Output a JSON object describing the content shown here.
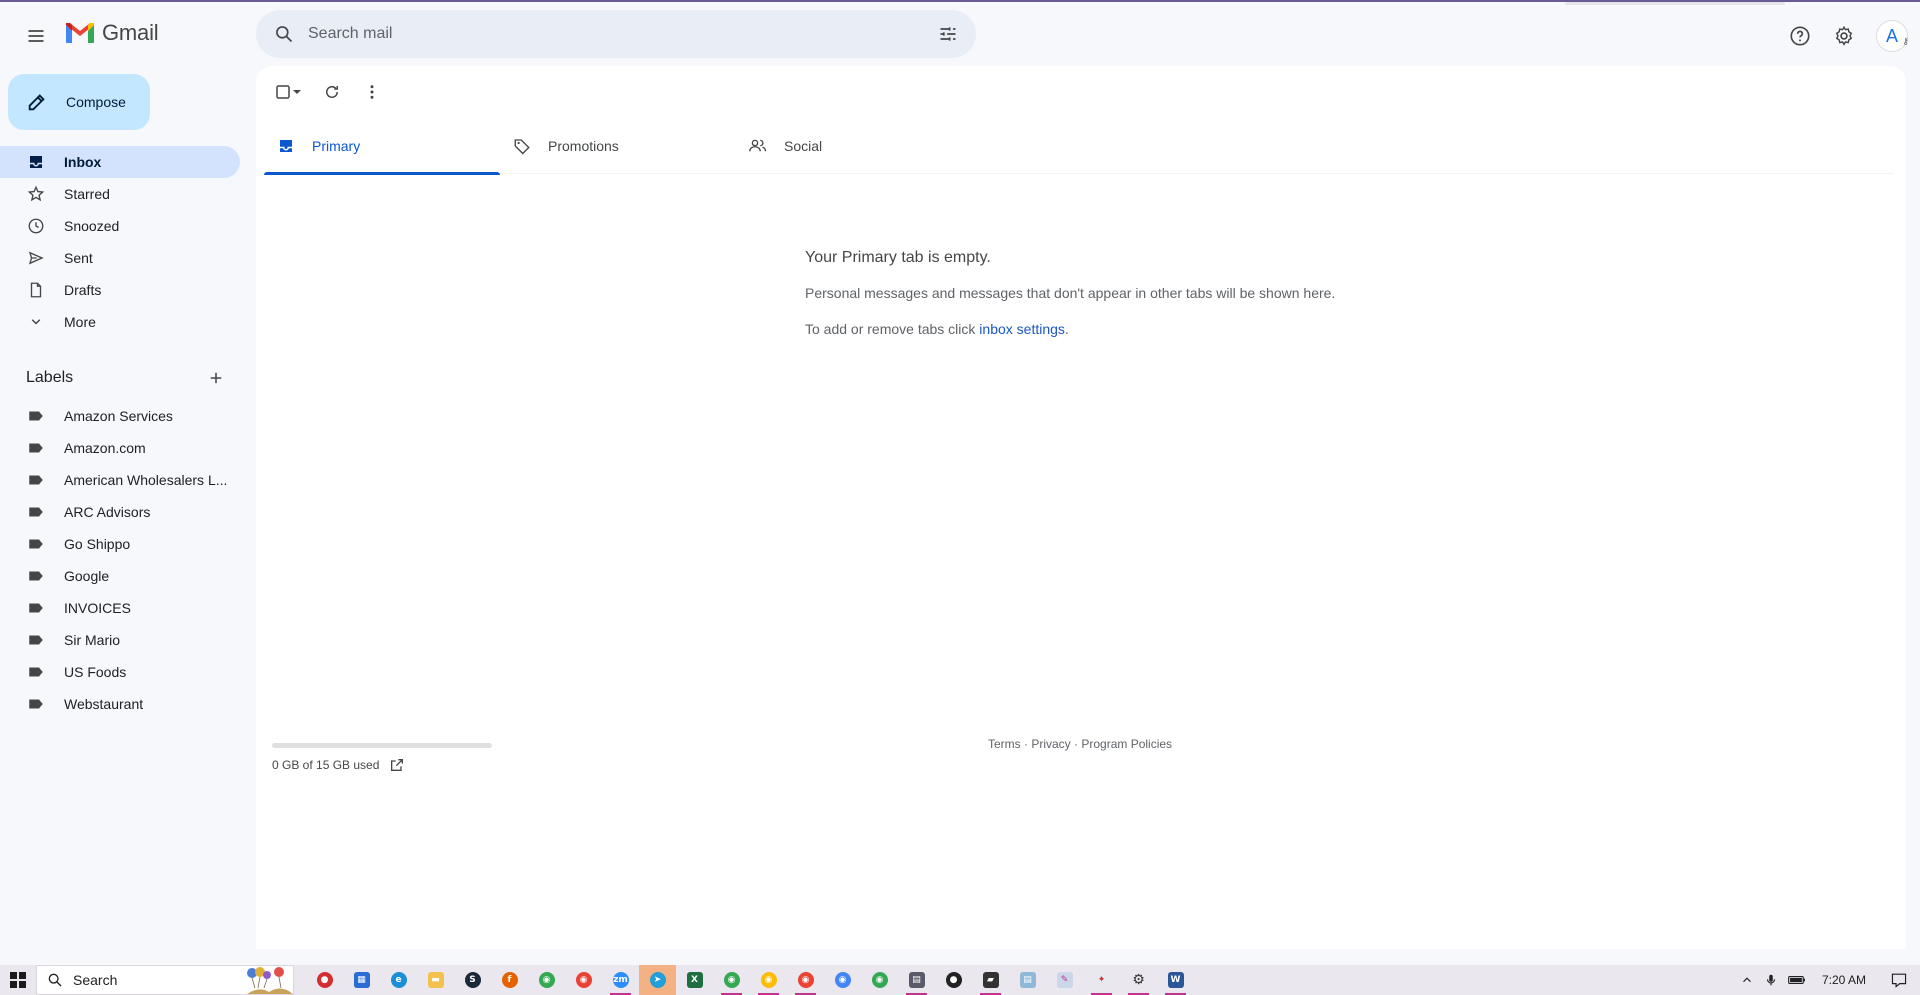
{
  "header": {
    "app_name": "Gmail",
    "search_placeholder": "Search mail",
    "avatar_letter": "A"
  },
  "sidebar": {
    "compose_label": "Compose",
    "nav": [
      {
        "label": "Inbox",
        "icon": "inbox-icon",
        "active": true
      },
      {
        "label": "Starred",
        "icon": "star-icon"
      },
      {
        "label": "Snoozed",
        "icon": "clock-icon"
      },
      {
        "label": "Sent",
        "icon": "send-icon"
      },
      {
        "label": "Drafts",
        "icon": "draft-icon"
      },
      {
        "label": "More",
        "icon": "chevron-down-icon"
      }
    ],
    "labels_title": "Labels",
    "labels": [
      "Amazon Services",
      "Amazon.com",
      "American Wholesalers L...",
      "ARC Advisors",
      "Go Shippo",
      "Google",
      "INVOICES",
      "Sir Mario",
      "US Foods",
      "Webstaurant"
    ]
  },
  "tabs": [
    {
      "label": "Primary",
      "icon": "inbox-tab-icon",
      "active": true
    },
    {
      "label": "Promotions",
      "icon": "tag-icon"
    },
    {
      "label": "Social",
      "icon": "people-icon"
    }
  ],
  "empty_state": {
    "title": "Your Primary tab is empty.",
    "description": "Personal messages and messages that don't appear in other tabs will be shown here.",
    "settings_prefix": "To add or remove tabs click ",
    "settings_link": "inbox settings",
    "settings_suffix": "."
  },
  "storage": {
    "text": "0 GB of 15 GB used",
    "used_fraction": 0
  },
  "footer": {
    "terms": "Terms",
    "privacy": "Privacy",
    "policies": "Program Policies",
    "separator": " · "
  },
  "taskbar": {
    "search_label": "Search",
    "clock": "7:20 AM"
  },
  "colors": {
    "accent": "#0b57d0",
    "compose_bg": "#c2e7ff",
    "active_nav_bg": "#d3e3fd",
    "page_bg": "#f6f8fc"
  }
}
